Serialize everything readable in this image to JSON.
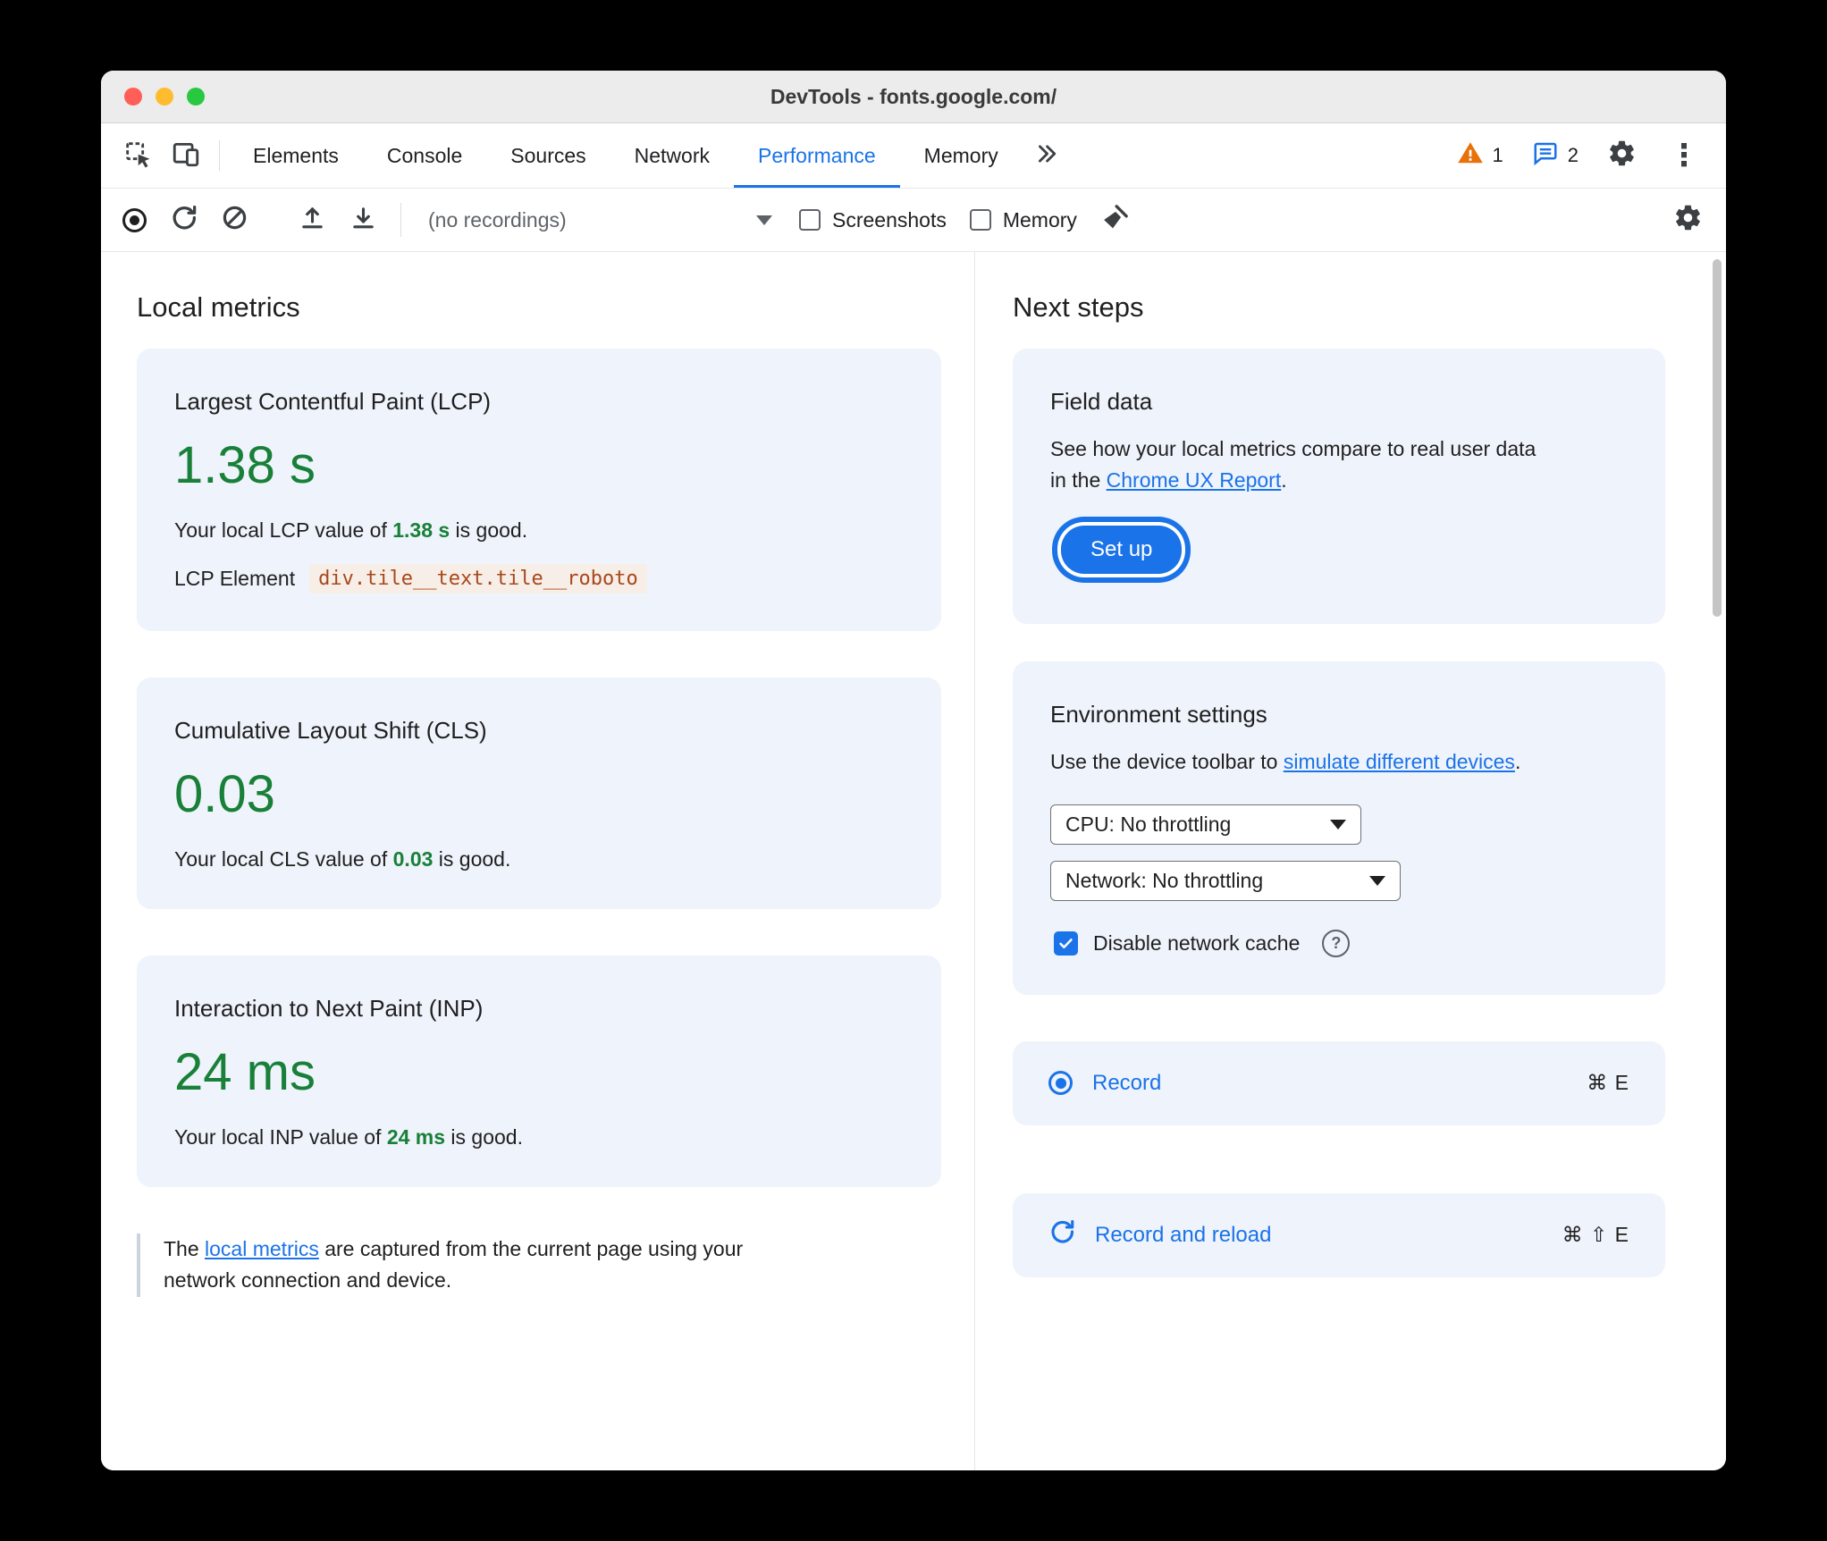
{
  "colors": {
    "accent": "#1a73e8",
    "good_green": "#188038",
    "warning_orange": "#e8710a",
    "node_link": "#a8471d"
  },
  "window": {
    "title": "DevTools - fonts.google.com/"
  },
  "tabbar": {
    "tabs": [
      "Elements",
      "Console",
      "Sources",
      "Network",
      "Performance",
      "Memory"
    ],
    "active_tab": "Performance",
    "warning_count": "1",
    "issue_count": "2"
  },
  "toolbar": {
    "recordings_select": "(no recordings)",
    "screenshots_label": "Screenshots",
    "memory_label": "Memory"
  },
  "local_metrics": {
    "heading": "Local metrics",
    "lcp": {
      "title": "Largest Contentful Paint (LCP)",
      "value": "1.38 s",
      "desc_prefix": "Your local LCP value of ",
      "desc_value": "1.38 s",
      "desc_suffix": " is good.",
      "element_label": "LCP Element",
      "element_node": "div.tile__text.tile__roboto"
    },
    "cls": {
      "title": "Cumulative Layout Shift (CLS)",
      "value": "0.03",
      "desc_prefix": "Your local CLS value of ",
      "desc_value": "0.03",
      "desc_suffix": " is good."
    },
    "inp": {
      "title": "Interaction to Next Paint (INP)",
      "value": "24 ms",
      "desc_prefix": "Your local INP value of ",
      "desc_value": "24 ms",
      "desc_suffix": " is good."
    },
    "footnote": {
      "prefix": "The ",
      "link": "local metrics",
      "suffix": " are captured from the current page using your network connection and device."
    }
  },
  "next_steps": {
    "heading": "Next steps",
    "field_data": {
      "title": "Field data",
      "body_prefix": "See how your local metrics compare to real user data in the ",
      "link": "Chrome UX Report",
      "body_suffix": ".",
      "button_label": "Set up"
    },
    "environment": {
      "title": "Environment settings",
      "body_prefix": "Use the device toolbar to ",
      "link": "simulate different devices",
      "body_suffix": ".",
      "cpu_select": "CPU: No throttling",
      "network_select": "Network: No throttling",
      "cache_checkbox_label": "Disable network cache"
    },
    "record": {
      "label": "Record",
      "shortcut": "⌘ E"
    },
    "record_reload": {
      "label": "Record and reload",
      "shortcut": "⌘ ⇧ E"
    }
  }
}
